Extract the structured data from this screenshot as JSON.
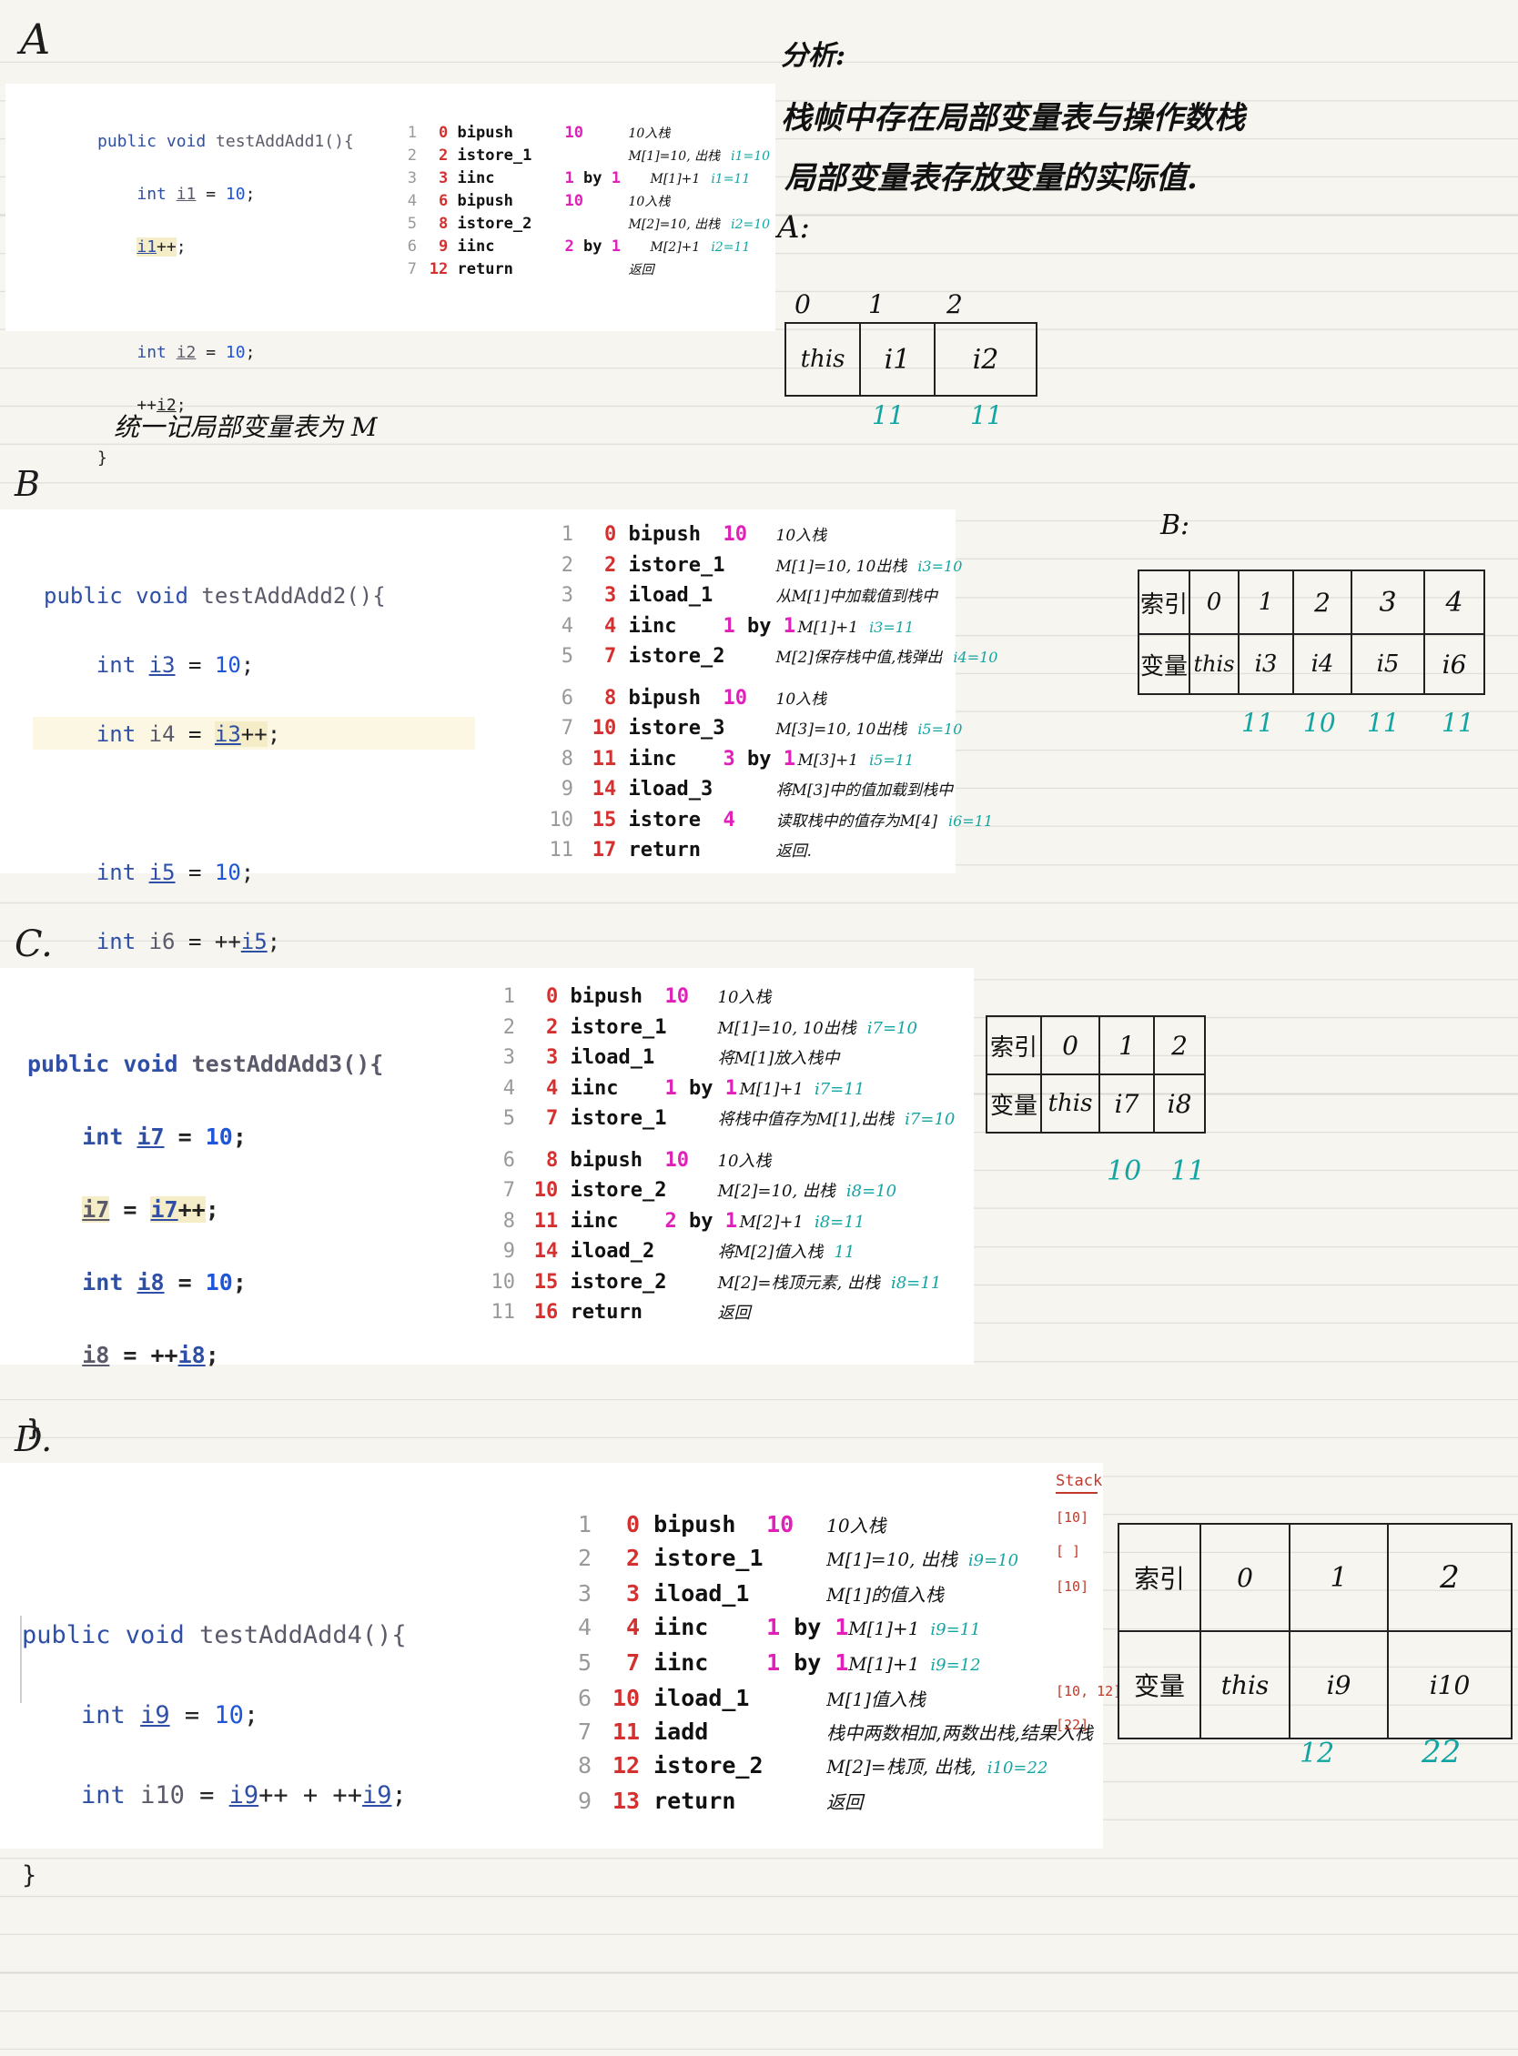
{
  "headings": {
    "A": "A",
    "B": "B",
    "C": "C.",
    "D": "D."
  },
  "analysis": {
    "title": "分析:",
    "line1": "栈帧中存在局部变量表与操作数栈",
    "line2": "局部变量表存放变量的实际值.",
    "a_label": "A:",
    "b_label": "B:",
    "m_note": "统一记局部变量表为 M"
  },
  "A": {
    "code": [
      "public void testAddAdd1(){",
      "int i1 = 10;",
      "i1++;",
      "",
      "int i2 = 10;",
      "++i2;",
      "}"
    ],
    "bytecode": [
      {
        "ln": "1",
        "off": "0",
        "op": "bipush",
        "arg": "10",
        "note": "10入栈",
        "val": ""
      },
      {
        "ln": "2",
        "off": "2",
        "op": "istore_1",
        "arg": "",
        "note": "M[1]=10, 出栈",
        "val": "i1=10"
      },
      {
        "ln": "3",
        "off": "3",
        "op": "iinc",
        "arg": "1 by 1",
        "note": "M[1]+1",
        "val": "i1=11"
      },
      {
        "ln": "4",
        "off": "6",
        "op": "bipush",
        "arg": "10",
        "note": "10入栈",
        "val": ""
      },
      {
        "ln": "5",
        "off": "8",
        "op": "istore_2",
        "arg": "",
        "note": "M[2]=10, 出栈",
        "val": "i2=10"
      },
      {
        "ln": "6",
        "off": "9",
        "op": "iinc",
        "arg": "2 by 1",
        "note": "M[2]+1",
        "val": "i2=11"
      },
      {
        "ln": "7",
        "off": "12",
        "op": "return",
        "arg": "",
        "note": "返回",
        "val": ""
      }
    ],
    "table": {
      "index": [
        "0",
        "1",
        "2"
      ],
      "vars": [
        "this",
        "i1",
        "i2"
      ],
      "values": [
        "11",
        "11"
      ]
    }
  },
  "B": {
    "code": [
      "public void testAddAdd2(){",
      "int i3 = 10;",
      "int i4 = i3++;",
      "",
      "int i5 = 10;",
      "int i6 = ++i5;",
      "}"
    ],
    "bytecode": [
      {
        "ln": "1",
        "off": "0",
        "op": "bipush",
        "arg": "10",
        "note": "10入栈",
        "val": ""
      },
      {
        "ln": "2",
        "off": "2",
        "op": "istore_1",
        "arg": "",
        "note": "M[1]=10, 10出栈",
        "val": "i3=10"
      },
      {
        "ln": "3",
        "off": "3",
        "op": "iload_1",
        "arg": "",
        "note": "从M[1]中加载值到栈中",
        "val": ""
      },
      {
        "ln": "4",
        "off": "4",
        "op": "iinc",
        "arg": "1 by 1",
        "note": "M[1]+1",
        "val": "i3=11"
      },
      {
        "ln": "5",
        "off": "7",
        "op": "istore_2",
        "arg": "",
        "note": "M[2]保存栈中值,栈弹出",
        "val": "i4=10"
      },
      {
        "ln": "6",
        "off": "8",
        "op": "bipush",
        "arg": "10",
        "note": "10入栈",
        "val": ""
      },
      {
        "ln": "7",
        "off": "10",
        "op": "istore_3",
        "arg": "",
        "note": "M[3]=10, 10出栈",
        "val": "i5=10"
      },
      {
        "ln": "8",
        "off": "11",
        "op": "iinc",
        "arg": "3 by 1",
        "note": "M[3]+1",
        "val": "i5=11"
      },
      {
        "ln": "9",
        "off": "14",
        "op": "iload_3",
        "arg": "",
        "note": "将M[3]中的值加载到栈中",
        "val": ""
      },
      {
        "ln": "10",
        "off": "15",
        "op": "istore",
        "arg": "4",
        "note": "读取栈中的值存为M[4]",
        "val": "i6=11"
      },
      {
        "ln": "11",
        "off": "17",
        "op": "return",
        "arg": "",
        "note": "返回.",
        "val": ""
      }
    ],
    "table": {
      "header_index": "索引",
      "header_var": "变量",
      "index": [
        "0",
        "1",
        "2",
        "3",
        "4"
      ],
      "vars": [
        "this",
        "i3",
        "i4",
        "i5",
        "i6"
      ],
      "values": [
        "11",
        "10",
        "11",
        "11"
      ]
    }
  },
  "C": {
    "code": [
      "public void testAddAdd3(){",
      "int i7 = 10;",
      "i7 = i7++;",
      "int i8 = 10;",
      "i8 = ++i8;",
      "}"
    ],
    "bytecode": [
      {
        "ln": "1",
        "off": "0",
        "op": "bipush",
        "arg": "10",
        "note": "10入栈",
        "val": ""
      },
      {
        "ln": "2",
        "off": "2",
        "op": "istore_1",
        "arg": "",
        "note": "M[1]=10, 10出栈",
        "val": "i7=10"
      },
      {
        "ln": "3",
        "off": "3",
        "op": "iload_1",
        "arg": "",
        "note": "将M[1]放入栈中",
        "val": ""
      },
      {
        "ln": "4",
        "off": "4",
        "op": "iinc",
        "arg": "1 by 1",
        "note": "M[1]+1",
        "val": "i7=11"
      },
      {
        "ln": "5",
        "off": "7",
        "op": "istore_1",
        "arg": "",
        "note": "将栈中值存为M[1],出栈",
        "val": "i7=10"
      },
      {
        "ln": "6",
        "off": "8",
        "op": "bipush",
        "arg": "10",
        "note": "10入栈",
        "val": ""
      },
      {
        "ln": "7",
        "off": "10",
        "op": "istore_2",
        "arg": "",
        "note": "M[2]=10, 出栈",
        "val": "i8=10"
      },
      {
        "ln": "8",
        "off": "11",
        "op": "iinc",
        "arg": "2 by 1",
        "note": "M[2]+1",
        "val": "i8=11"
      },
      {
        "ln": "9",
        "off": "14",
        "op": "iload_2",
        "arg": "",
        "note": "将M[2]值入栈",
        "val": "11"
      },
      {
        "ln": "10",
        "off": "15",
        "op": "istore_2",
        "arg": "",
        "note": "M[2]=栈顶元素, 出栈",
        "val": "i8=11"
      },
      {
        "ln": "11",
        "off": "16",
        "op": "return",
        "arg": "",
        "note": "返回",
        "val": ""
      }
    ],
    "table": {
      "header_index": "索引",
      "header_var": "变量",
      "index": [
        "0",
        "1",
        "2"
      ],
      "vars": [
        "this",
        "i7",
        "i8"
      ],
      "values": [
        "10",
        "11"
      ]
    }
  },
  "D": {
    "code": [
      "public void testAddAdd4(){",
      "int i9 = 10;",
      "int i10 = i9++ + ++i9;",
      "}"
    ],
    "bytecode": [
      {
        "ln": "1",
        "off": "0",
        "op": "bipush",
        "arg": "10",
        "note": "10入栈",
        "val": "",
        "stack": "[10]"
      },
      {
        "ln": "2",
        "off": "2",
        "op": "istore_1",
        "arg": "",
        "note": "M[1]=10, 出栈",
        "val": "i9=10",
        "stack": "[ ]"
      },
      {
        "ln": "3",
        "off": "3",
        "op": "iload_1",
        "arg": "",
        "note": "M[1]的值入栈",
        "val": "",
        "stack": "[10]"
      },
      {
        "ln": "4",
        "off": "4",
        "op": "iinc",
        "arg": "1 by 1",
        "note": "M[1]+1",
        "val": "i9=11",
        "stack": ""
      },
      {
        "ln": "5",
        "off": "7",
        "op": "iinc",
        "arg": "1 by 1",
        "note": "M[1]+1",
        "val": "i9=12",
        "stack": ""
      },
      {
        "ln": "6",
        "off": "10",
        "op": "iload_1",
        "arg": "",
        "note": "M[1]值入栈",
        "val": "",
        "stack": "[10, 12]"
      },
      {
        "ln": "7",
        "off": "11",
        "op": "iadd",
        "arg": "",
        "note": "栈中两数相加,两数出栈,结果入栈",
        "val": "",
        "stack": "[22]"
      },
      {
        "ln": "8",
        "off": "12",
        "op": "istore_2",
        "arg": "",
        "note": "M[2]=栈顶, 出栈,",
        "val": "i10=22",
        "stack": ""
      },
      {
        "ln": "9",
        "off": "13",
        "op": "return",
        "arg": "",
        "note": "返回",
        "val": "",
        "stack": ""
      }
    ],
    "stack_label": "Stack",
    "table": {
      "header_index": "索引",
      "header_var": "变量",
      "index": [
        "0",
        "1",
        "2"
      ],
      "vars": [
        "this",
        "i9",
        "i10"
      ],
      "values": [
        "12",
        "22"
      ]
    }
  }
}
